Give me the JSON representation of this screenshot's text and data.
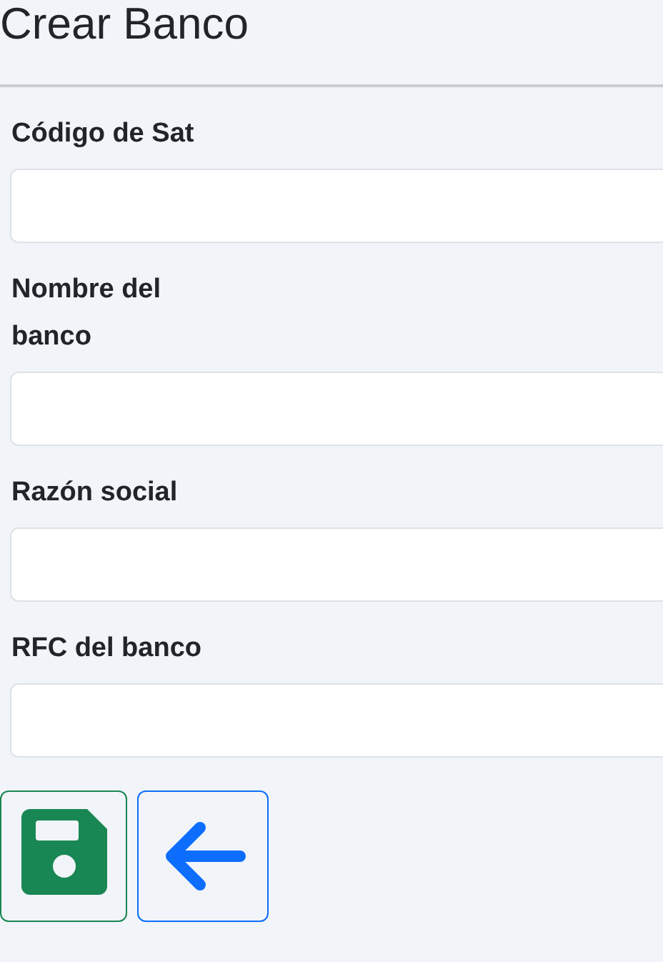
{
  "title": "Crear Banco",
  "fields": [
    {
      "label": "Código de Sat"
    },
    {
      "label": "Nombre del banco"
    },
    {
      "label": "Razón social"
    },
    {
      "label": "RFC del banco"
    }
  ]
}
